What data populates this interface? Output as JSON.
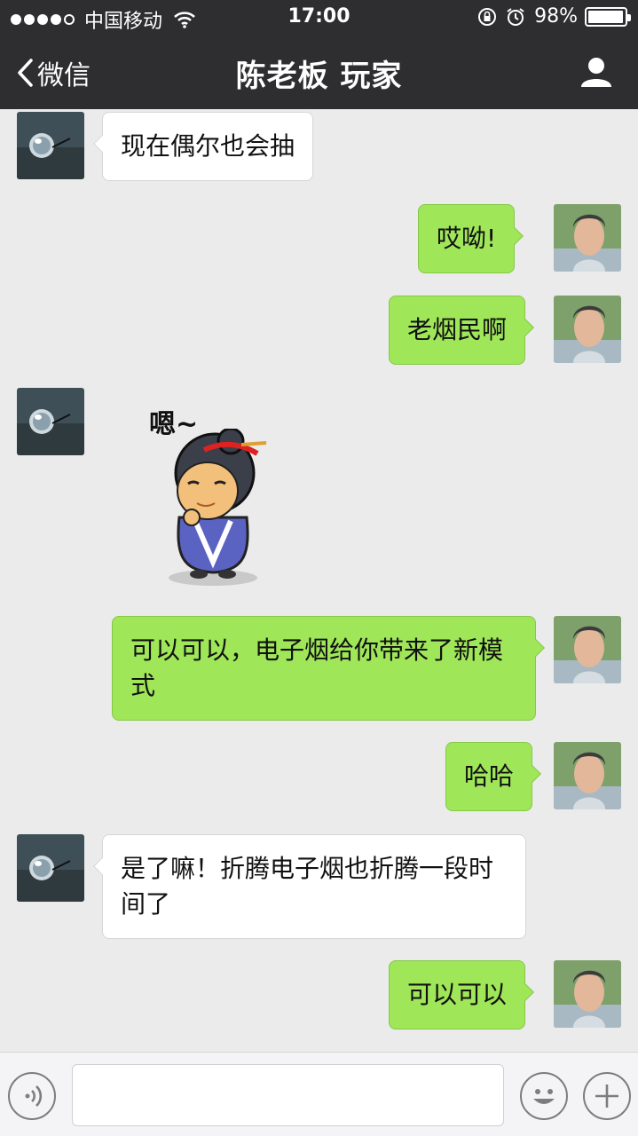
{
  "status_bar": {
    "carrier": "中国移动",
    "time": "17:00",
    "battery": "98%",
    "battery_level": 0.98,
    "signal_bars": 4
  },
  "nav": {
    "back_label": "微信",
    "title": "陈老板 玩家"
  },
  "messages": [
    {
      "from": "other",
      "text": "现在偶尔也会抽"
    },
    {
      "from": "me",
      "text": "哎呦!"
    },
    {
      "from": "me",
      "text": "老烟民啊"
    },
    {
      "from": "other",
      "sticker_text": "嗯~"
    },
    {
      "from": "me",
      "text": "可以可以，电子烟给你带来了新模式"
    },
    {
      "from": "me",
      "text": "哈哈"
    },
    {
      "from": "other",
      "text": "是了嘛！折腾电子烟也折腾一段时间了"
    },
    {
      "from": "me",
      "text": "可以可以"
    }
  ],
  "input": {
    "value": ""
  },
  "colors": {
    "header_bg": "#2e2e31",
    "chat_bg": "#ebebeb",
    "bubble_out": "#9fe658",
    "bubble_in": "#ffffff"
  },
  "icons": [
    "back-chevron-icon",
    "profile-icon",
    "voice-icon",
    "emoji-icon",
    "plus-icon",
    "wifi-icon",
    "lock-rotation-icon",
    "alarm-icon"
  ]
}
